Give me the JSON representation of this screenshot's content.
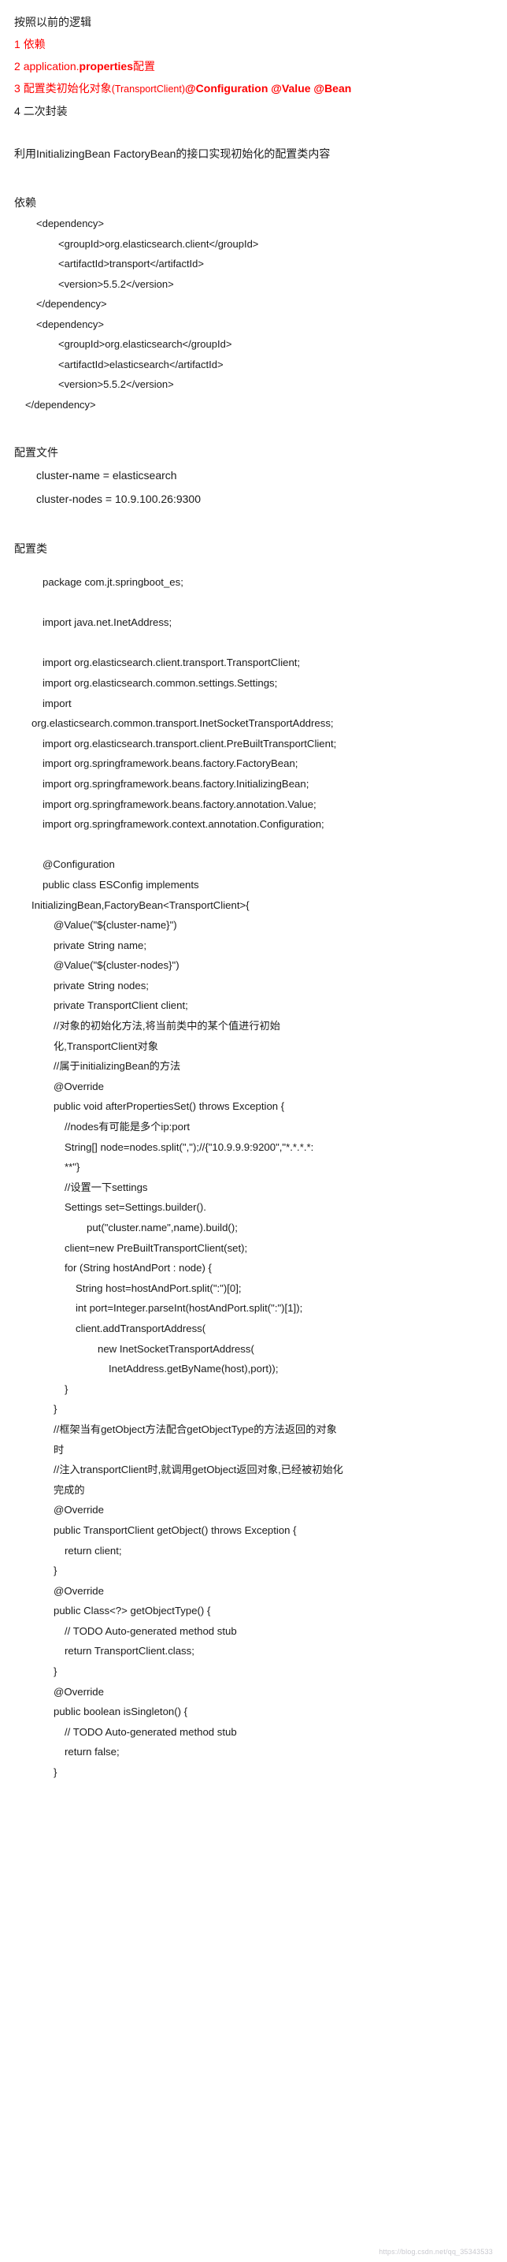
{
  "intro": {
    "heading": "按照以前的逻辑",
    "steps": [
      {
        "num": "1 ",
        "text": "依赖",
        "color": "#ff0000",
        "bold_part": ""
      },
      {
        "num": "2 ",
        "text": "application.",
        "color": "#ff0000",
        "bold_part": "properties",
        "tail": "配置"
      },
      {
        "num": "3 ",
        "text": "配置类初始化对象",
        "color": "#ff0000",
        "small_part": "(TransportClient)",
        "bold_part": "@Configuration @Value @Bean"
      },
      {
        "num": "4 ",
        "text": "二次封装",
        "color": "#1a1a1a",
        "bold_part": ""
      }
    ],
    "summary": "利用InitializingBean FactoryBean的接口实现初始化的配置类内容"
  },
  "dependency_section": {
    "title": "依赖",
    "lines": [
      {
        "indent": 1,
        "text": "<dependency>"
      },
      {
        "indent": 3,
        "text": "<groupId>org.elasticsearch.client</groupId>"
      },
      {
        "indent": 3,
        "text": "<artifactId>transport</artifactId>"
      },
      {
        "indent": 3,
        "text": "<version>5.5.2</version>"
      },
      {
        "indent": 1,
        "text": "</dependency>"
      },
      {
        "indent": 1,
        "text": "<dependency>"
      },
      {
        "indent": 3,
        "text": "<groupId>org.elasticsearch</groupId>"
      },
      {
        "indent": 3,
        "text": "<artifactId>elasticsearch</artifactId>"
      },
      {
        "indent": 3,
        "text": "<version>5.5.2</version>"
      },
      {
        "indent": 0,
        "text": "</dependency>"
      }
    ]
  },
  "properties_section": {
    "title": "配置文件",
    "lines": [
      {
        "indent": 1,
        "text": "cluster-name = elasticsearch"
      },
      {
        "indent": 1,
        "text": "cluster-nodes = 10.9.100.26:9300"
      }
    ]
  },
  "config_class_section": {
    "title": "配置类",
    "lines": [
      {
        "indent": 1,
        "text": "package com.jt.springboot_es;"
      },
      {
        "indent": 0,
        "text": ""
      },
      {
        "indent": 1,
        "text": "import java.net.InetAddress;"
      },
      {
        "indent": 0,
        "text": ""
      },
      {
        "indent": 1,
        "text": "import org.elasticsearch.client.transport.TransportClient;"
      },
      {
        "indent": 1,
        "text": "import org.elasticsearch.common.settings.Settings;"
      },
      {
        "indent": 1,
        "text": "import"
      },
      {
        "indent": 0,
        "text": "org.elasticsearch.common.transport.InetSocketTransportAddress;"
      },
      {
        "indent": 1,
        "text": "import org.elasticsearch.transport.client.PreBuiltTransportClient;"
      },
      {
        "indent": 1,
        "text": "import org.springframework.beans.factory.FactoryBean;"
      },
      {
        "indent": 1,
        "text": "import org.springframework.beans.factory.InitializingBean;"
      },
      {
        "indent": 1,
        "text": "import org.springframework.beans.factory.annotation.Value;"
      },
      {
        "indent": 1,
        "text": "import org.springframework.context.annotation.Configuration;"
      },
      {
        "indent": 0,
        "text": ""
      },
      {
        "indent": 1,
        "text": "@Configuration"
      },
      {
        "indent": 1,
        "text": "public class ESConfig implements"
      },
      {
        "indent": 0,
        "text": "InitializingBean,FactoryBean<TransportClient>{"
      },
      {
        "indent": 2,
        "text": "@Value(\"${cluster-name}\")"
      },
      {
        "indent": 2,
        "text": "private String name;"
      },
      {
        "indent": 2,
        "text": "@Value(\"${cluster-nodes}\")"
      },
      {
        "indent": 2,
        "text": "private String nodes;"
      },
      {
        "indent": 2,
        "text": "private TransportClient client;"
      },
      {
        "indent": 2,
        "text": "//对象的初始化方法,将当前类中的某个值进行初始"
      },
      {
        "indent": 2,
        "text": "化,TransportClient对象"
      },
      {
        "indent": 2,
        "text": "//属于initializingBean的方法"
      },
      {
        "indent": 2,
        "text": "@Override"
      },
      {
        "indent": 2,
        "text": "public void afterPropertiesSet() throws Exception {"
      },
      {
        "indent": 3,
        "text": "//nodes有可能是多个ip:port"
      },
      {
        "indent": 3,
        "text": "String[] node=nodes.split(\",\");//{\"10.9.9.9:9200\",\"*.*.*.*:"
      },
      {
        "indent": 3,
        "text": "**\"}"
      },
      {
        "indent": 3,
        "text": "//设置一下settings"
      },
      {
        "indent": 3,
        "text": "Settings set=Settings.builder()."
      },
      {
        "indent": 5,
        "text": "put(\"cluster.name\",name).build();"
      },
      {
        "indent": 3,
        "text": "client=new PreBuiltTransportClient(set);"
      },
      {
        "indent": 3,
        "text": "for (String hostAndPort : node) {"
      },
      {
        "indent": 4,
        "text": "String host=hostAndPort.split(\":\")[0];"
      },
      {
        "indent": 4,
        "text": "int port=Integer.parseInt(hostAndPort.split(\":\")[1]);"
      },
      {
        "indent": 4,
        "text": "client.addTransportAddress("
      },
      {
        "indent": 6,
        "text": "new InetSocketTransportAddress("
      },
      {
        "indent": 7,
        "text": "InetAddress.getByName(host),port));"
      },
      {
        "indent": 3,
        "text": "}"
      },
      {
        "indent": 2,
        "text": "}"
      },
      {
        "indent": 2,
        "text": "//框架当有getObject方法配合getObjectType的方法返回的对象"
      },
      {
        "indent": 2,
        "text": "时"
      },
      {
        "indent": 2,
        "text": "//注入transportClient时,就调用getObject返回对象,已经被初始化"
      },
      {
        "indent": 2,
        "text": "完成的"
      },
      {
        "indent": 2,
        "text": "@Override"
      },
      {
        "indent": 2,
        "text": "public TransportClient getObject() throws Exception {"
      },
      {
        "indent": 3,
        "text": "return client;"
      },
      {
        "indent": 2,
        "text": "}"
      },
      {
        "indent": 2,
        "text": "@Override"
      },
      {
        "indent": 2,
        "text": "public Class<?> getObjectType() {"
      },
      {
        "indent": 3,
        "text": "// TODO Auto-generated method stub"
      },
      {
        "indent": 3,
        "text": "return TransportClient.class;"
      },
      {
        "indent": 2,
        "text": "}"
      },
      {
        "indent": 2,
        "text": "@Override"
      },
      {
        "indent": 2,
        "text": "public boolean isSingleton() {"
      },
      {
        "indent": 3,
        "text": "// TODO Auto-generated method stub"
      },
      {
        "indent": 3,
        "text": "return false;"
      },
      {
        "indent": 2,
        "text": "}"
      }
    ]
  },
  "watermark": "https://blog.csdn.net/qq_35343533"
}
